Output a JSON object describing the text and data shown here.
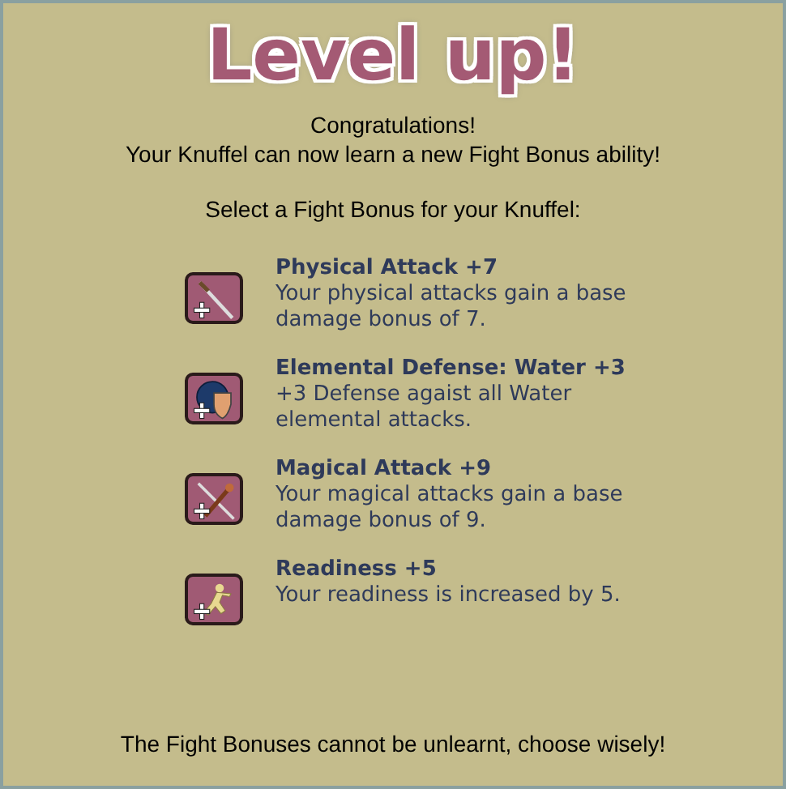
{
  "title": "Level up!",
  "intro": [
    "Congratulations!",
    "Your Knuffel can now learn a new Fight Bonus ability!"
  ],
  "prompt": "Select a Fight Bonus for your Knuffel:",
  "bonuses": [
    {
      "kind": "sword",
      "name": "Physical Attack +7",
      "description": "Your physical attacks gain a base damage bonus of 7."
    },
    {
      "kind": "shield",
      "name": "Elemental Defense: Water +3",
      "description": "+3 Defense agaist all Water elemental attacks."
    },
    {
      "kind": "staff",
      "name": "Magical Attack +9",
      "description": "Your magical attacks gain a base damage bonus of 9."
    },
    {
      "kind": "runner",
      "name": "Readiness +5",
      "description": "Your readiness is increased by 5."
    }
  ],
  "footer": "The Fight Bonuses cannot be unlearnt, choose wisely!"
}
